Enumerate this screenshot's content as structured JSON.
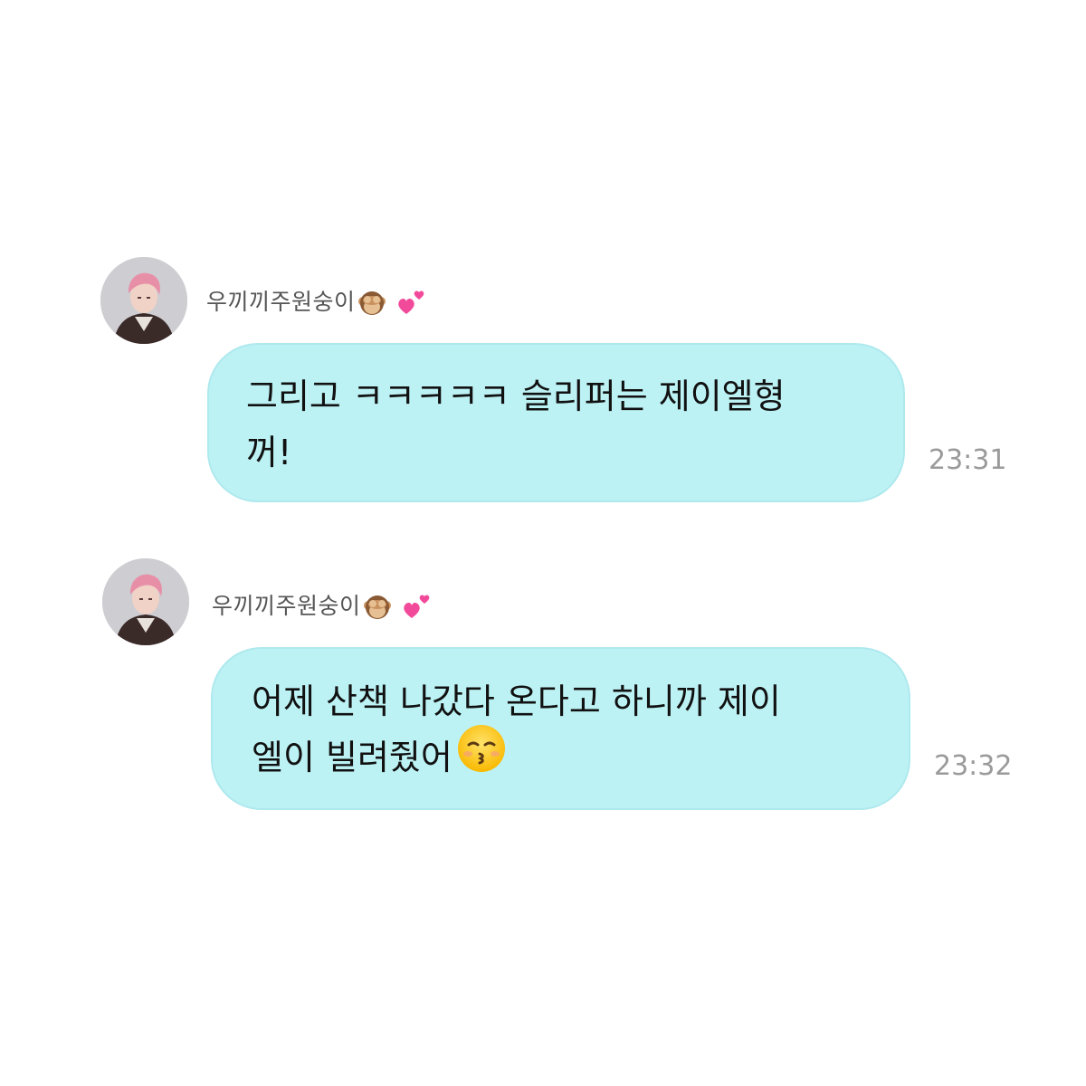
{
  "messages": [
    {
      "sender": "우끼끼주원숭이",
      "sender_icons": [
        "see-no-evil-monkey-icon",
        "two-hearts-icon"
      ],
      "lines": [
        "그리고 ㅋㅋㅋㅋㅋ 슬리퍼는 제이엘형",
        "꺼!"
      ],
      "time": "23:31"
    },
    {
      "sender": "우끼끼주원숭이",
      "sender_icons": [
        "see-no-evil-monkey-icon",
        "two-hearts-icon"
      ],
      "lines": [
        "어제 산책 나갔다 온다고 하니까 제이",
        "엘이 빌려줬어"
      ],
      "trailing_icon": "kissing-face-closed-eyes-icon",
      "time": "23:32"
    }
  ],
  "colors": {
    "bubble": "#bdf2f5",
    "bubble_border": "#aee9ee",
    "text": "#111111",
    "sender": "#555555",
    "time": "#9a9a9a",
    "background": "#ffffff"
  }
}
